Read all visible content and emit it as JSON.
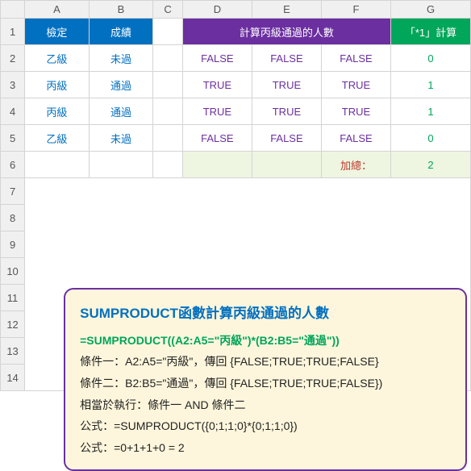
{
  "columns": [
    "A",
    "B",
    "C",
    "D",
    "E",
    "F",
    "G"
  ],
  "row_numbers": [
    "1",
    "2",
    "3",
    "4",
    "5",
    "6",
    "7",
    "8",
    "9",
    "10",
    "11",
    "12",
    "13",
    "14"
  ],
  "header": {
    "col_a": "檢定",
    "col_b": "成績",
    "col_def": "計算丙級通過的人數",
    "col_g": "「*1」計算"
  },
  "rows": [
    {
      "a": "乙級",
      "b": "未過",
      "d": "FALSE",
      "e": "FALSE",
      "f": "FALSE",
      "g": "0"
    },
    {
      "a": "丙級",
      "b": "通過",
      "d": "TRUE",
      "e": "TRUE",
      "f": "TRUE",
      "g": "1"
    },
    {
      "a": "丙級",
      "b": "通過",
      "d": "TRUE",
      "e": "TRUE",
      "f": "TRUE",
      "g": "1"
    },
    {
      "a": "乙級",
      "b": "未過",
      "d": "FALSE",
      "e": "FALSE",
      "f": "FALSE",
      "g": "0"
    }
  ],
  "sum": {
    "label": "加總：",
    "value": "2"
  },
  "callout": {
    "title": "SUMPRODUCT函數計算丙級通過的人數",
    "formula": "=SUMPRODUCT((A2:A5=\"丙級\")*(B2:B5=\"通過\"))",
    "line1": "條件一：A2:A5=\"丙級\"，傳回 {FALSE;TRUE;TRUE;FALSE}",
    "line2": "條件二：B2:B5=\"通過\"，傳回 {FALSE;TRUE;TRUE;FALSE})",
    "line3": "相當於執行：條件一 AND 條件二",
    "line4": "公式：=SUMPRODUCT({0;1;1;0}*{0;1;1;0})",
    "line5": "公式：=0+1+1+0 = 2"
  }
}
